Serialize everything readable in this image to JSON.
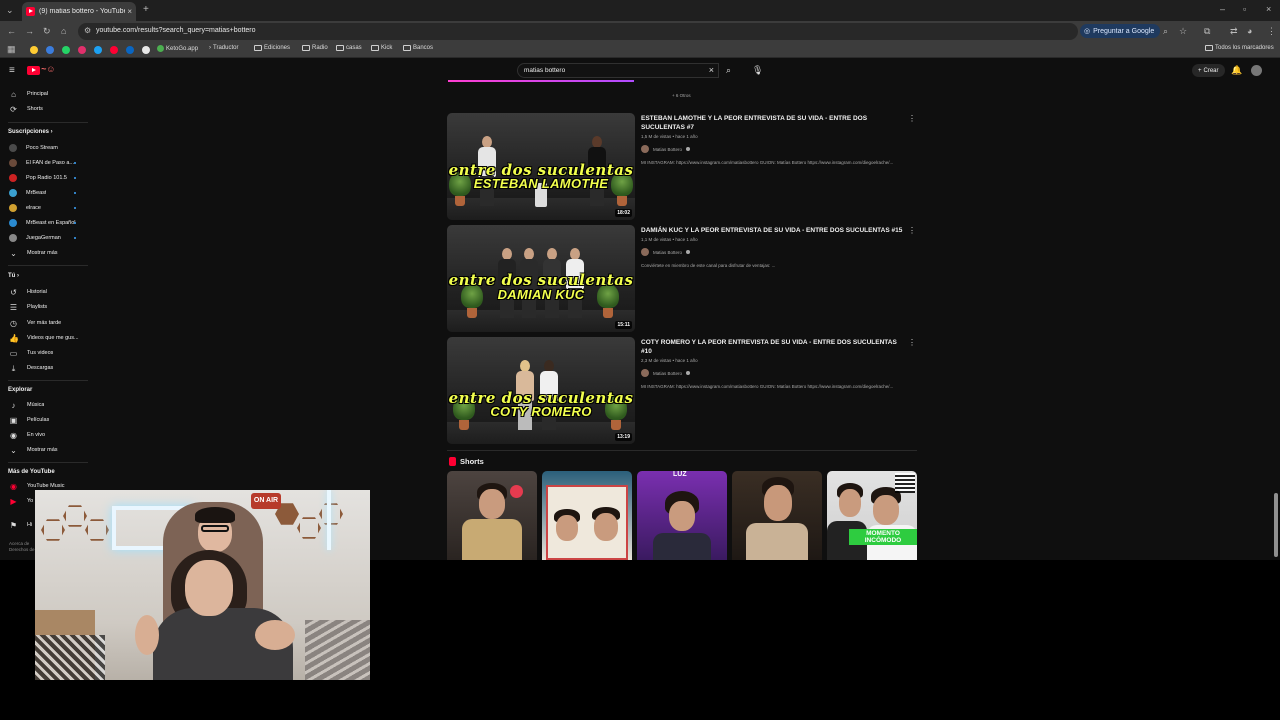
{
  "browser": {
    "tab_title": "(9) matias bottero - YouTube",
    "url": "youtube.com/results?search_query=matias+bottero",
    "ask_google": "Preguntar a Google",
    "all_bookmarks": "Todos los marcadores",
    "bookmarks": [
      "KetoGo.app",
      "Traductor",
      "Ediciones",
      "Radio",
      "casas",
      "Kick",
      "Bancos"
    ]
  },
  "youtube": {
    "search_query": "matias bottero",
    "create_label": "Crear",
    "sidebar": {
      "main": [
        {
          "label": "Principal",
          "icon": "home-icon"
        },
        {
          "label": "Shorts",
          "icon": "shorts-icon"
        }
      ],
      "subscriptions_header": "Suscripciones",
      "subscriptions": [
        {
          "label": "Poco Stream",
          "color": "#4a4a4a"
        },
        {
          "label": "El FAN de Paso a...",
          "color": "#6a4a3a"
        },
        {
          "label": "Pop Radio 101.5",
          "color": "#cc2222"
        },
        {
          "label": "MrBeast",
          "color": "#3aa0d0"
        },
        {
          "label": "elrace",
          "color": "#d0a030"
        },
        {
          "label": "MrBeast en Español",
          "color": "#2a8ad0"
        },
        {
          "label": "JuegaGerman",
          "color": "#888888"
        }
      ],
      "show_more": "Mostrar más",
      "you_header": "Tú",
      "you": [
        {
          "label": "Historial",
          "icon": "history-icon"
        },
        {
          "label": "Playlists",
          "icon": "playlist-icon"
        },
        {
          "label": "Ver más tarde",
          "icon": "clock-icon"
        },
        {
          "label": "Videos que me gus...",
          "icon": "thumbs-up-icon"
        },
        {
          "label": "Tus videos",
          "icon": "video-icon"
        },
        {
          "label": "Descargas",
          "icon": "download-icon"
        }
      ],
      "explore_header": "Explorar",
      "explore": [
        {
          "label": "Música",
          "icon": "music-icon"
        },
        {
          "label": "Películas",
          "icon": "film-icon"
        },
        {
          "label": "En vivo",
          "icon": "live-icon"
        }
      ],
      "explore_more": "Mostrar más",
      "more_header": "Más de YouTube",
      "more": [
        {
          "label": "YouTube Music"
        },
        {
          "label": "Yo"
        }
      ],
      "settings_label": "Hi",
      "footer": "Acerca de\nDerechos de"
    },
    "more_line": "+ 6 Otros",
    "results": [
      {
        "title": "ESTEBAN LAMOTHE Y LA PEOR ENTREVISTA DE SU VIDA - ENTRE DOS SUCULENTAS #7",
        "meta": "1,5 M de vistas • hace 1 año",
        "channel": "Matias Bottero",
        "desc": "MI INSTAGRAM: https://www.instagram.com/matiasbottero GUION: Matías Bottero https://www.instagram.com/diegoelrache/...",
        "thumb_script": "entre dos suculentas",
        "thumb_name": "ESTEBAN LAMOTHE",
        "duration": "18:02"
      },
      {
        "title": "DAMIÁN KUC Y LA PEOR ENTREVISTA DE SU VIDA - ENTRE DOS SUCULENTAS #15",
        "meta": "1,1 M de vistas • hace 1 año",
        "channel": "Matias Bottero",
        "desc": "Conviértete en miembro de este canal para disfrutar de ventajas: ...",
        "thumb_script": "entre dos suculentas",
        "thumb_name": "DAMIAN KUC",
        "duration": "15:11"
      },
      {
        "title": "COTY ROMERO Y LA PEOR ENTREVISTA DE SU VIDA - ENTRE DOS SUCULENTAS #10",
        "meta": "2,3 M de vistas • hace 1 año",
        "channel": "Matias Bottero",
        "desc": "MI INSTAGRAM: https://www.instagram.com/matiasbottero GUION: Matías Bottero https://www.instagram.com/diegoelrache/...",
        "thumb_script": "entre dos suculentas",
        "thumb_name": "COTY ROMERO",
        "duration": "13:19"
      }
    ],
    "shorts_header": "Shorts",
    "shorts_overlay": "MOMENTO INCÓMODO"
  },
  "webcam": {
    "sign": "ON AIR"
  },
  "colors": {
    "accent": "#ff0033",
    "thumb_text": "#f2ff4d",
    "link_blue": "#3ea6ff",
    "shorts_green": "#2ecc40"
  }
}
